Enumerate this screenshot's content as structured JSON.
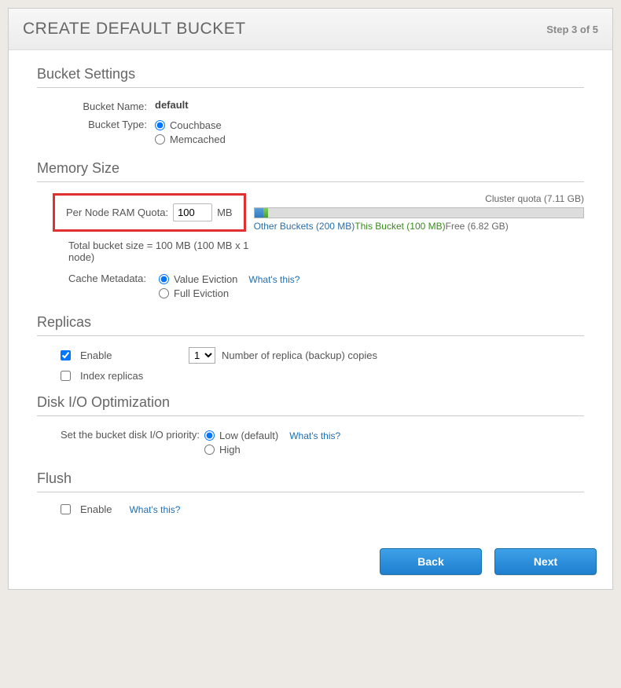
{
  "header": {
    "title": "CREATE DEFAULT BUCKET",
    "step": "Step 3 of 5"
  },
  "bucket_settings": {
    "title": "Bucket Settings",
    "name_label": "Bucket Name:",
    "name_value": "default",
    "type_label": "Bucket Type:",
    "type_options": {
      "couchbase": "Couchbase",
      "memcached": "Memcached"
    }
  },
  "memory": {
    "title": "Memory Size",
    "quota_label": "Per Node RAM Quota:",
    "quota_value": "100",
    "quota_unit": "MB",
    "cluster_quota": "Cluster quota (7.11 GB)",
    "legend": {
      "other": "Other Buckets (200 MB)",
      "this": "This Bucket (100 MB)",
      "free": "Free (6.82 GB)"
    },
    "total_line": "Total bucket size = 100 MB (100 MB x 1 node)",
    "cache_label": "Cache Metadata:",
    "cache_options": {
      "value": "Value Eviction",
      "full": "Full Eviction"
    },
    "help": "What's this?"
  },
  "replicas": {
    "title": "Replicas",
    "enable": "Enable",
    "count_value": "1",
    "count_label": "Number of replica (backup) copies",
    "index": "Index replicas"
  },
  "diskio": {
    "title": "Disk I/O Optimization",
    "label": "Set the bucket disk I/O priority:",
    "options": {
      "low": "Low (default)",
      "high": "High"
    },
    "help": "What's this?"
  },
  "flush": {
    "title": "Flush",
    "enable": "Enable",
    "help": "What's this?"
  },
  "footer": {
    "back": "Back",
    "next": "Next"
  }
}
